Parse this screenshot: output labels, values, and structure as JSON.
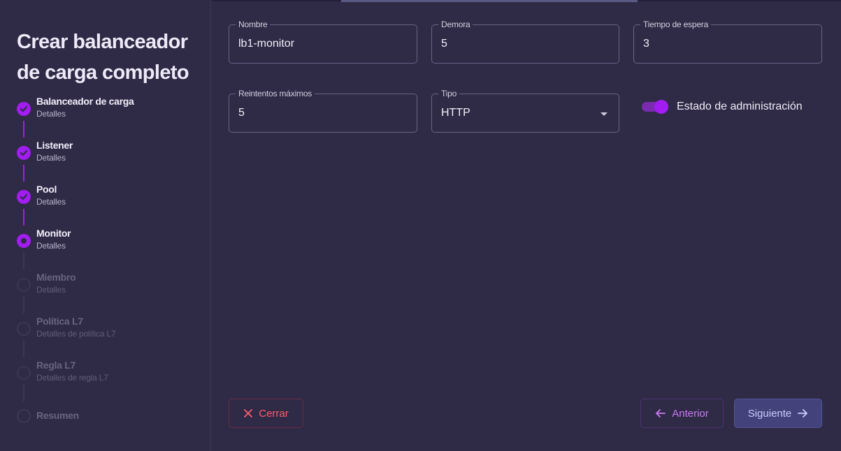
{
  "wizard": {
    "title": "Crear balanceador de carga completo",
    "steps": [
      {
        "label": "Balanceador de carga",
        "sub": "Detalles",
        "state": "done"
      },
      {
        "label": "Listener",
        "sub": "Detalles",
        "state": "done"
      },
      {
        "label": "Pool",
        "sub": "Detalles",
        "state": "done"
      },
      {
        "label": "Monitor",
        "sub": "Detalles",
        "state": "active"
      },
      {
        "label": "Miembro",
        "sub": "Detalles",
        "state": "pending"
      },
      {
        "label": "Política L7",
        "sub": "Detalles de política L7",
        "state": "pending"
      },
      {
        "label": "Regla L7",
        "sub": "Detalles de regla L7",
        "state": "pending"
      },
      {
        "label": "Resumen",
        "sub": "",
        "state": "pending"
      }
    ]
  },
  "form": {
    "name": {
      "label": "Nombre",
      "value": "lb1-monitor"
    },
    "delay": {
      "label": "Demora",
      "value": "5"
    },
    "timeout": {
      "label": "Tiempo de espera",
      "value": "3"
    },
    "max_retries": {
      "label": "Reintentos máximos",
      "value": "5"
    },
    "type": {
      "label": "Tipo",
      "value": "HTTP"
    },
    "admin_state": {
      "label": "Estado de administración",
      "on": true
    }
  },
  "actions": {
    "close": "Cerrar",
    "previous": "Anterior",
    "next": "Siguiente"
  },
  "colors": {
    "accent": "#a11df0",
    "danger": "#ff5d72",
    "background": "#2f2a45"
  }
}
